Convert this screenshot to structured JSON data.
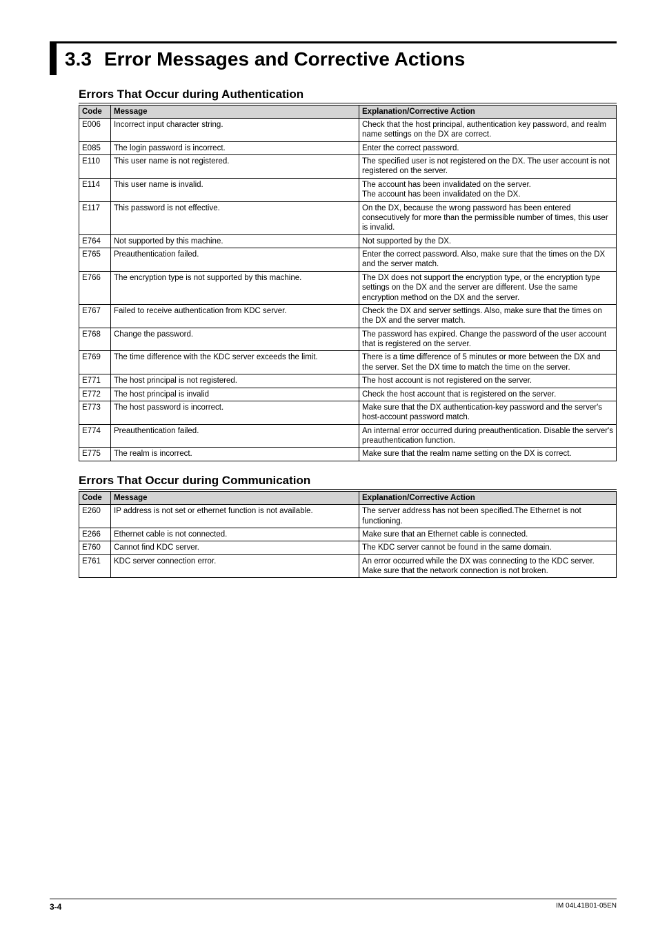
{
  "section": {
    "number": "3.3",
    "title": "Error Messages and Corrective Actions"
  },
  "auth": {
    "heading": "Errors That Occur during Authentication",
    "columns": {
      "code": "Code",
      "message": "Message",
      "explanation": "Explanation/Corrective Action"
    },
    "rows": [
      {
        "code": "E006",
        "msg": "Incorrect input character string.",
        "exp": "Check that the host principal, authentication key password, and realm name settings on the DX are correct."
      },
      {
        "code": "E085",
        "msg": "The login password is incorrect.",
        "exp": "Enter the correct password."
      },
      {
        "code": "E110",
        "msg": "This user name is not registered.",
        "exp": "The specified user is not registered on the DX. The user account is not registered on the server."
      },
      {
        "code": "E114",
        "msg": "This user name is invalid.",
        "exp": "The account has been invalidated on the server.\nThe account has been invalidated on the DX."
      },
      {
        "code": "E117",
        "msg": "This password is not effective.",
        "exp": "On the DX, because the wrong password has been entered consecutively for more than the permissible number of times, this user is invalid."
      },
      {
        "code": "E764",
        "msg": "Not supported by this machine.",
        "exp": "Not supported by the DX."
      },
      {
        "code": "E765",
        "msg": "Preauthentication failed.",
        "exp": "Enter the correct password. Also, make sure that the times on the DX and the server match."
      },
      {
        "code": "E766",
        "msg": "The encryption type is not supported by this machine.",
        "exp": "The DX does not support the encryption type, or the encryption type settings on the DX and the server are different. Use the same encryption method on the DX and the server."
      },
      {
        "code": "E767",
        "msg": "Failed to receive authentication from KDC server.",
        "exp": "Check the DX and server settings. Also, make sure that the times on the DX and the server match."
      },
      {
        "code": "E768",
        "msg": "Change the password.",
        "exp": "The password has expired. Change the password of the user account that is registered on the server."
      },
      {
        "code": "E769",
        "msg": "The time difference with the KDC server exceeds the limit.",
        "exp": "There is a time difference of 5 minutes or more between the DX and the server. Set the DX time to match the time on the server."
      },
      {
        "code": "E771",
        "msg": "The host principal is not registered.",
        "exp": "The host account is not registered on the server."
      },
      {
        "code": "E772",
        "msg": "The host principal is invalid",
        "exp": "Check the host account that is registered on the server."
      },
      {
        "code": "E773",
        "msg": "The host password is incorrect.",
        "exp": "Make sure that the DX authentication-key password and the server's host-account password match."
      },
      {
        "code": "E774",
        "msg": "Preauthentication failed.",
        "exp": "An internal error occurred during preauthentication. Disable the server's preauthentication function."
      },
      {
        "code": "E775",
        "msg": "The realm is incorrect.",
        "exp": "Make sure that the realm name setting on the DX is correct."
      }
    ]
  },
  "comm": {
    "heading": "Errors That Occur during Communication",
    "columns": {
      "code": "Code",
      "message": "Message",
      "explanation": "Explanation/Corrective Action"
    },
    "rows": [
      {
        "code": "E260",
        "msg": "IP address is not set or ethernet function is not available.",
        "exp": "The server address has not been specified.The Ethernet is not functioning."
      },
      {
        "code": "E266",
        "msg": "Ethernet cable is not connected.",
        "exp": "Make sure that an Ethernet cable is connected."
      },
      {
        "code": "E760",
        "msg": "Cannot find KDC server.",
        "exp": "The KDC server cannot be found in the same domain."
      },
      {
        "code": "E761",
        "msg": "KDC server connection error.",
        "exp": "An error occurred while the DX was connecting to the KDC server. Make sure that the network connection is not broken."
      }
    ]
  },
  "footer": {
    "page": "3-4",
    "doc": "IM 04L41B01-05EN"
  }
}
